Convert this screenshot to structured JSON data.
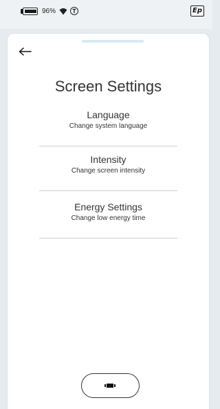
{
  "status_bar": {
    "battery_percent": 96,
    "battery_text": "96%",
    "logo_text": "Ep",
    "icons": [
      "battery-icon",
      "wifi-icon",
      "circle-t-icon",
      "ep-logo"
    ]
  },
  "page": {
    "back_icon": "arrow-left-icon",
    "title": "Screen Settings"
  },
  "menu": {
    "items": [
      {
        "label": "Language",
        "description": "Change system language"
      },
      {
        "label": "Intensity",
        "description": "Change screen intensity"
      },
      {
        "label": "Energy Settings",
        "description": "Change low energy time"
      }
    ]
  },
  "bottom": {
    "home_icon": "device-icon"
  },
  "colors": {
    "background": "#e6ebef",
    "panel": "#ffffff",
    "text": "#333333",
    "divider": "#cfcfcf",
    "handle": "#d9e9f1"
  }
}
